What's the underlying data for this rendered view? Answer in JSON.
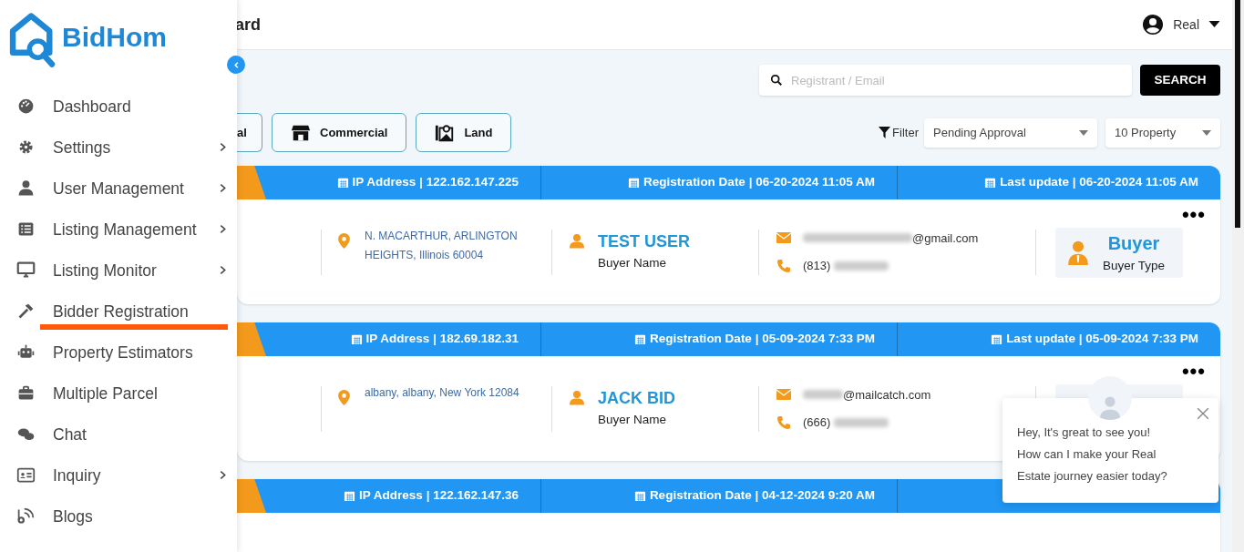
{
  "brand": {
    "name": "BidHom"
  },
  "sidebar": {
    "items": [
      {
        "label": "Dashboard",
        "has_submenu": false,
        "selected": false
      },
      {
        "label": "Settings",
        "has_submenu": true,
        "selected": false
      },
      {
        "label": "User Management",
        "has_submenu": true,
        "selected": false
      },
      {
        "label": "Listing Management",
        "has_submenu": true,
        "selected": false
      },
      {
        "label": "Listing Monitor",
        "has_submenu": true,
        "selected": false
      },
      {
        "label": "Bidder Registration",
        "has_submenu": false,
        "selected": true
      },
      {
        "label": "Property Estimators",
        "has_submenu": false,
        "selected": false
      },
      {
        "label": "Multiple Parcel",
        "has_submenu": false,
        "selected": false
      },
      {
        "label": "Chat",
        "has_submenu": false,
        "selected": false
      },
      {
        "label": "Inquiry",
        "has_submenu": true,
        "selected": false
      },
      {
        "label": "Blogs",
        "has_submenu": false,
        "selected": false
      }
    ]
  },
  "header": {
    "title": "ard",
    "user": "Real"
  },
  "search": {
    "placeholder": "Registrant / Email",
    "button": "SEARCH"
  },
  "property_tabs": [
    {
      "label": "al"
    },
    {
      "label": "Commercial"
    },
    {
      "label": "Land"
    }
  ],
  "filter": {
    "label": "Filter",
    "status": "Pending Approval",
    "count": "10 Property"
  },
  "registrations": [
    {
      "ip": "IP Address | 122.162.147.225",
      "registration_date": "Registration Date | 06-20-2024 11:05 AM",
      "last_update": "Last update | 06-20-2024 11:05 AM",
      "more": "•••",
      "address": "N. MACARTHUR, ARLINGTON HEIGHTS, Illinois 60004",
      "buyer_name": "TEST USER",
      "buyer_name_label": "Buyer Name",
      "email": "@gmail.com",
      "phone": "(813)",
      "buyer_type": "Buyer",
      "buyer_type_label": "Buyer Type"
    },
    {
      "ip": "IP Address | 182.69.182.31",
      "registration_date": "Registration Date | 05-09-2024 7:33 PM",
      "last_update": "Last update | 05-09-2024 7:33 PM",
      "more": "•••",
      "address": "albany, albany, New York 12084",
      "buyer_name": "JACK BID",
      "buyer_name_label": "Buyer Name",
      "email": "@mailcatch.com",
      "phone": "(666)"
    },
    {
      "ip": "IP Address | 122.162.147.36",
      "registration_date": "Registration Date | 04-12-2024 9:20 AM"
    }
  ],
  "chat_popup": {
    "lines": [
      "Hey, It's great to see you!",
      "How can I make your Real",
      "Estate journey easier today?"
    ]
  }
}
